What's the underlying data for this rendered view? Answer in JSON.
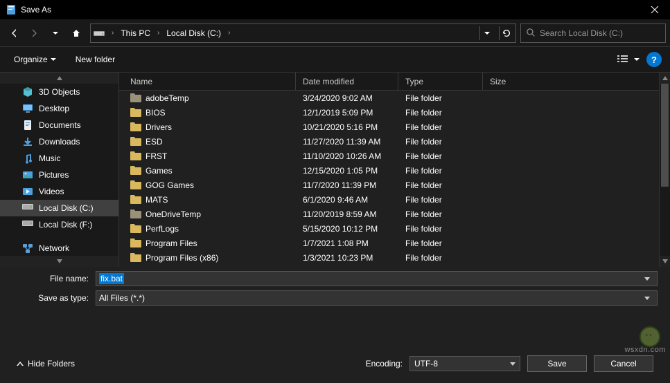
{
  "title": "Save As",
  "breadcrumb": {
    "loc1": "This PC",
    "loc2": "Local Disk (C:)"
  },
  "search": {
    "placeholder": "Search Local Disk (C:)"
  },
  "toolbar": {
    "organize": "Organize",
    "newfolder": "New folder"
  },
  "nav": {
    "items": [
      {
        "label": "3D Objects"
      },
      {
        "label": "Desktop"
      },
      {
        "label": "Documents"
      },
      {
        "label": "Downloads"
      },
      {
        "label": "Music"
      },
      {
        "label": "Pictures"
      },
      {
        "label": "Videos"
      },
      {
        "label": "Local Disk (C:)",
        "selected": true
      },
      {
        "label": "Local Disk (F:)"
      }
    ],
    "network": "Network"
  },
  "headers": {
    "name": "Name",
    "date": "Date modified",
    "type": "Type",
    "size": "Size"
  },
  "files": [
    {
      "name": "adobeTemp",
      "date": "3/24/2020 9:02 AM",
      "type": "File folder",
      "color": "#9b9078"
    },
    {
      "name": "BIOS",
      "date": "12/1/2019 5:09 PM",
      "type": "File folder",
      "color": "#d9b85e"
    },
    {
      "name": "Drivers",
      "date": "10/21/2020 5:16 PM",
      "type": "File folder",
      "color": "#d9b85e"
    },
    {
      "name": "ESD",
      "date": "11/27/2020 11:39 AM",
      "type": "File folder",
      "color": "#d9b85e"
    },
    {
      "name": "FRST",
      "date": "11/10/2020 10:26 AM",
      "type": "File folder",
      "color": "#d9b85e"
    },
    {
      "name": "Games",
      "date": "12/15/2020 1:05 PM",
      "type": "File folder",
      "color": "#d9b85e"
    },
    {
      "name": "GOG Games",
      "date": "11/7/2020 11:39 PM",
      "type": "File folder",
      "color": "#d9b85e"
    },
    {
      "name": "MATS",
      "date": "6/1/2020 9:46 AM",
      "type": "File folder",
      "color": "#d9b85e"
    },
    {
      "name": "OneDriveTemp",
      "date": "11/20/2019 8:59 AM",
      "type": "File folder",
      "color": "#9b9078"
    },
    {
      "name": "PerfLogs",
      "date": "5/15/2020 10:12 PM",
      "type": "File folder",
      "color": "#d9b85e"
    },
    {
      "name": "Program Files",
      "date": "1/7/2021 1:08 PM",
      "type": "File folder",
      "color": "#d9b85e"
    },
    {
      "name": "Program Files (x86)",
      "date": "1/3/2021 10:23 PM",
      "type": "File folder",
      "color": "#d9b85e"
    }
  ],
  "form": {
    "filename_label": "File name:",
    "filename_value": "fix.bat",
    "type_label": "Save as type:",
    "type_value": "All Files  (*.*)"
  },
  "footer": {
    "hide": "Hide Folders",
    "encoding_label": "Encoding:",
    "encoding_value": "UTF-8",
    "save": "Save",
    "cancel": "Cancel"
  },
  "watermark": "wsxdn.com"
}
